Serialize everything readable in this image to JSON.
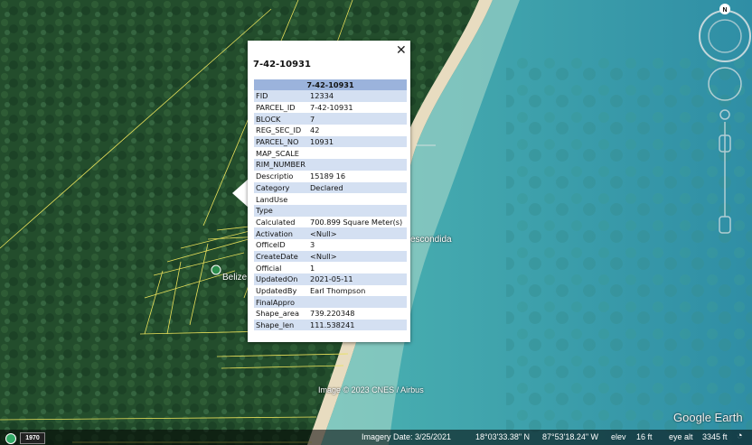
{
  "popup": {
    "title": "7-42-10931",
    "table_header": "7-42-10931",
    "rows": [
      {
        "key": "FID",
        "value": "12334"
      },
      {
        "key": "PARCEL_ID",
        "value": "7-42-10931"
      },
      {
        "key": "BLOCK",
        "value": "7"
      },
      {
        "key": "REG_SEC_ID",
        "value": "42"
      },
      {
        "key": "PARCEL_NO",
        "value": "10931"
      },
      {
        "key": "MAP_SCALE",
        "value": ""
      },
      {
        "key": "RIM_NUMBER",
        "value": ""
      },
      {
        "key": "Descriptio",
        "value": "15189 16"
      },
      {
        "key": "Category",
        "value": "Declared"
      },
      {
        "key": "LandUse",
        "value": ""
      },
      {
        "key": "Type",
        "value": ""
      },
      {
        "key": "Calculated",
        "value": "700.899 Square Meter(s)"
      },
      {
        "key": "Activation",
        "value": "<Null>"
      },
      {
        "key": "OfficeID",
        "value": "3"
      },
      {
        "key": "CreateDate",
        "value": "<Null>"
      },
      {
        "key": "Official",
        "value": "1"
      },
      {
        "key": "UpdatedOn",
        "value": "2021-05-11"
      },
      {
        "key": "UpdatedBy",
        "value": "Earl Thompson"
      },
      {
        "key": "FinalAppro",
        "value": ""
      },
      {
        "key": "Shape_area",
        "value": "739.220348"
      },
      {
        "key": "Shape_len",
        "value": "111.538241"
      }
    ]
  },
  "map": {
    "place_belize": "Belize",
    "place_escondida": "escondida",
    "attribution": "Image © 2023 CNES / Airbus",
    "logo": "Google Earth",
    "compass_label": "N"
  },
  "status_bar": {
    "year": "1970",
    "imagery_date": "Imagery Date: 3/25/2021",
    "lat": "18°03'33.38\" N",
    "lon": "87°53'18.24\" W",
    "elev_label": "elev",
    "elev_value": "16 ft",
    "eye_alt_label": "eye alt",
    "eye_alt_value": "3345 ft"
  },
  "colors": {
    "forest": "#1f4a2a",
    "sea": "#4fb7b3",
    "popup_header": "#9bb3dc",
    "row_alt": "#d4e0f2",
    "parcel_lines": "#e8e05a"
  }
}
